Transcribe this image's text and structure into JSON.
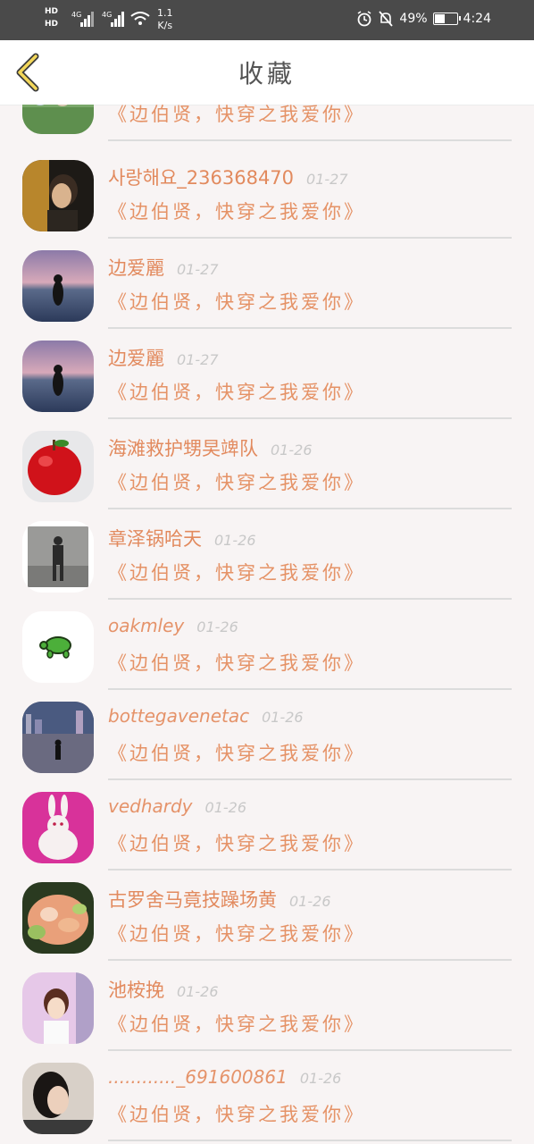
{
  "status_bar": {
    "hd1": "HD",
    "hd2": "HD",
    "net1": "4G",
    "net2": "4G",
    "speed_value": "1.1",
    "speed_unit": "K/s",
    "battery_text": "49%",
    "battery_level": 0.49,
    "time": "4:24"
  },
  "nav": {
    "title": "收藏",
    "back_icon": "chevron-left-icon"
  },
  "items": [
    {
      "name": "",
      "date": "",
      "book": "《边伯贤，快穿之我爱你》",
      "avatar_icon": "people-field-photo"
    },
    {
      "name": "사랑해요_236368470",
      "date": "01-27",
      "book": "《边伯贤，快穿之我爱你》",
      "avatar_icon": "dark-portrait-photo"
    },
    {
      "name": "边爱麗",
      "date": "01-27",
      "book": "《边伯贤，快穿之我爱你》",
      "avatar_icon": "girl-seaside-photo"
    },
    {
      "name": "边爱麗",
      "date": "01-27",
      "book": "《边伯贤，快穿之我爱你》",
      "avatar_icon": "girl-seaside-photo"
    },
    {
      "name": "海滩救护甥旲䇑队",
      "date": "01-26",
      "book": "《边伯贤，快穿之我爱你》",
      "avatar_icon": "red-apple-photo"
    },
    {
      "name": "章泽锅哈天",
      "date": "01-26",
      "book": "《边伯贤，快穿之我爱你》",
      "avatar_icon": "person-walking-photo"
    },
    {
      "name": "oakmley",
      "date": "01-26",
      "book": "《边伯贤，快穿之我爱你》",
      "avatar_icon": "turtle-icon"
    },
    {
      "name": "bottegavenetac",
      "date": "01-26",
      "book": "《边伯贤，快穿之我爱你》",
      "avatar_icon": "night-city-photo"
    },
    {
      "name": "vedhardy",
      "date": "01-26",
      "book": "《边伯贤，快穿之我爱你》",
      "avatar_icon": "white-rabbit-photo"
    },
    {
      "name": "古罗舍马竟技躁场黄",
      "date": "01-26",
      "book": "《边伯贤，快穿之我爱你》",
      "avatar_icon": "food-photo"
    },
    {
      "name": "池桉挽",
      "date": "01-26",
      "book": "《边伯贤，快穿之我爱你》",
      "avatar_icon": "girl-smiling-photo"
    },
    {
      "name": "............_691600861",
      "date": "01-26",
      "book": "《边伯贤，快穿之我爱你》",
      "avatar_icon": "girl-profile-photo"
    }
  ]
}
